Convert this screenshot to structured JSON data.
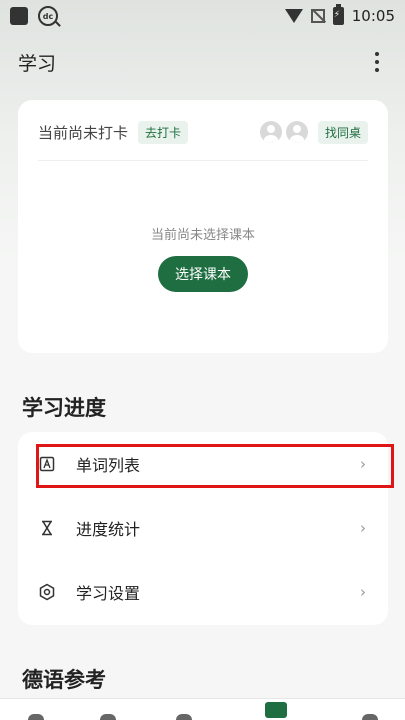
{
  "status_bar": {
    "time": "10:05"
  },
  "app_bar": {
    "title": "学习"
  },
  "checkin": {
    "status_text": "当前尚未打卡",
    "checkin_chip": "去打卡",
    "find_partner_chip": "找同桌"
  },
  "course": {
    "empty_text": "当前尚未选择课本",
    "select_button": "选择课本"
  },
  "progress_section": {
    "title": "学习进度",
    "items": [
      {
        "label": "单词列表",
        "icon": "vocabulary-icon"
      },
      {
        "label": "进度统计",
        "icon": "hourglass-icon"
      },
      {
        "label": "学习设置",
        "icon": "settings-icon"
      }
    ]
  },
  "reference_section": {
    "title": "德语参考"
  },
  "colors": {
    "accent": "#1f6e42",
    "highlight": "#e01515"
  }
}
